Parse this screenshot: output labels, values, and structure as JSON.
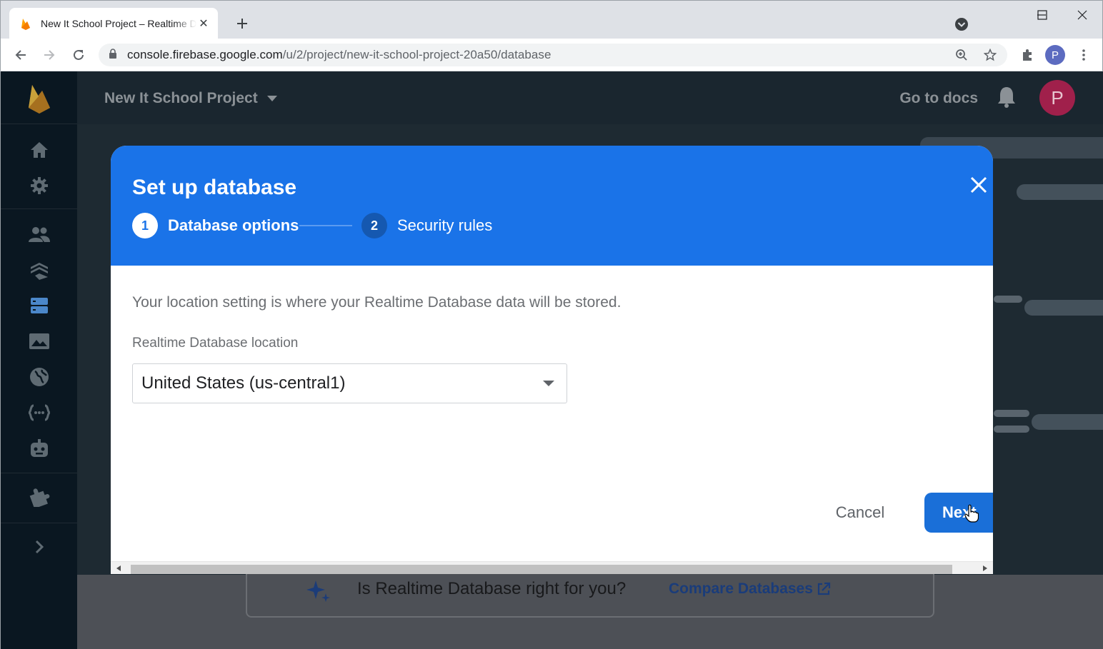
{
  "browser": {
    "tab_title": "New It School Project – Realtime Database – Firebase console",
    "url_host": "console.firebase.google.com",
    "url_path": "/u/2/project/new-it-school-project-20a50/database",
    "profile_initial": "P"
  },
  "app": {
    "project_name": "New It School Project",
    "go_to_docs": "Go to docs",
    "avatar_initial": "P",
    "sidebar": [
      {
        "icon": "home-icon"
      },
      {
        "icon": "gear-icon"
      },
      {
        "icon": "users-icon"
      },
      {
        "icon": "firestore-icon"
      },
      {
        "icon": "database-icon"
      },
      {
        "icon": "storage-icon"
      },
      {
        "icon": "hosting-icon"
      },
      {
        "icon": "functions-icon"
      },
      {
        "icon": "ml-icon"
      },
      {
        "icon": "extensions-icon"
      },
      {
        "icon": "expand-icon"
      }
    ]
  },
  "dialog": {
    "title": "Set up database",
    "steps": [
      {
        "number": "1",
        "label": "Database options"
      },
      {
        "number": "2",
        "label": "Security rules"
      }
    ],
    "description": "Your location setting is where your Realtime Database data will be stored.",
    "location_label": "Realtime Database location",
    "location_value": "United States (us-central1)",
    "cancel_label": "Cancel",
    "next_label": "Next"
  },
  "behind": {
    "question": "Is Realtime Database right for you?",
    "compare_link": "Compare Databases"
  },
  "colors": {
    "accent": "#1a73e8",
    "sidebar_bg": "#0a1721",
    "avatar_bg": "#a0204b"
  }
}
